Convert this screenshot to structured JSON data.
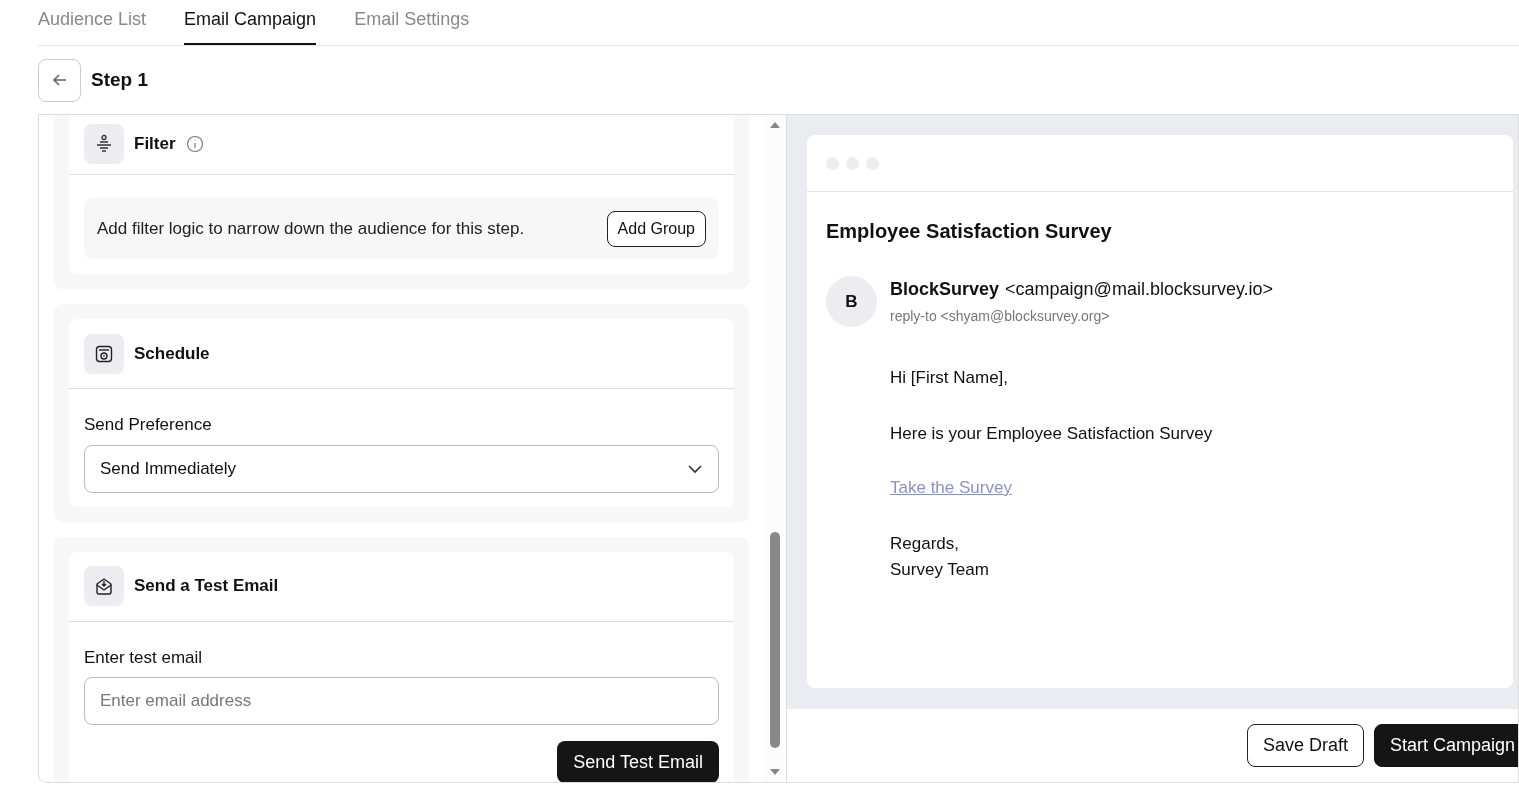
{
  "tabs": [
    {
      "label": "Audience List",
      "selected": false
    },
    {
      "label": "Email Campaign",
      "selected": true
    },
    {
      "label": "Email Settings",
      "selected": false
    }
  ],
  "step": {
    "title": "Step 1"
  },
  "filter": {
    "title": "Filter",
    "description": "Add filter logic to narrow down the audience for this step.",
    "button": "Add Group"
  },
  "schedule": {
    "title": "Schedule",
    "label": "Send Preference",
    "value": "Send Immediately"
  },
  "test_email": {
    "title": "Send a Test Email",
    "label": "Enter test email",
    "placeholder": "Enter email address",
    "button": "Send Test Email"
  },
  "preview": {
    "subject": "Employee Satisfaction Survey",
    "avatar": "B",
    "sender_name": "BlockSurvey",
    "sender_email": "<campaign@mail.blocksurvey.io>",
    "reply_to": "reply-to <shyam@blocksurvey.org>",
    "greeting": "Hi [First Name],",
    "body": "Here is your Employee Satisfaction Survey",
    "link": "Take the Survey",
    "closing": [
      "Regards,",
      "Survey Team"
    ]
  },
  "footer": {
    "buttons": [
      {
        "label": "Save Draft",
        "kind": "outline"
      },
      {
        "label": "Start Campaign",
        "kind": "primary"
      }
    ]
  }
}
